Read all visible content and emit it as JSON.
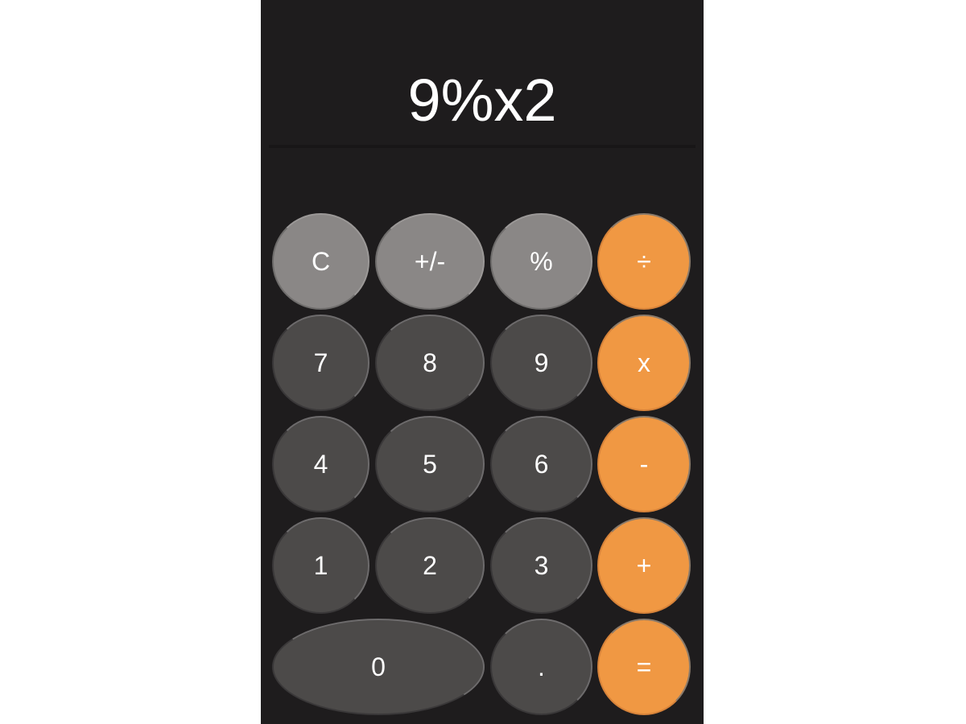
{
  "display": {
    "expression": "9%x2"
  },
  "keys": {
    "clear": "C",
    "sign": "+/-",
    "percent": "%",
    "divide": "÷",
    "seven": "7",
    "eight": "8",
    "nine": "9",
    "multiply": "x",
    "four": "4",
    "five": "5",
    "six": "6",
    "subtract": "-",
    "one": "1",
    "two": "2",
    "three": "3",
    "add": "+",
    "zero": "0",
    "decimal": ".",
    "equals": "="
  },
  "colors": {
    "background": "#1e1c1d",
    "function_key": "#8a8786",
    "number_key": "#4c4a49",
    "operator_key": "#f09843",
    "text": "#ffffff"
  }
}
